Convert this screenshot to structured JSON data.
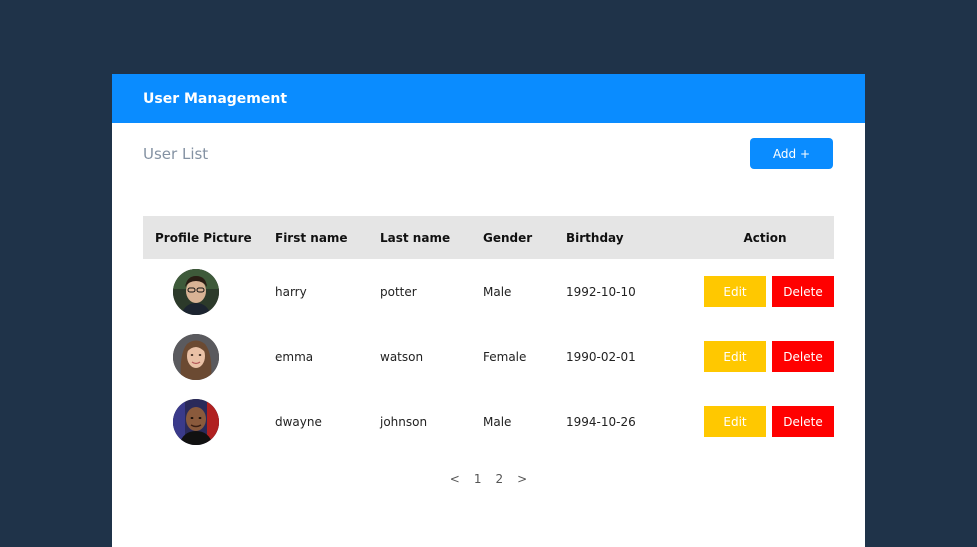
{
  "header": {
    "title": "User Management"
  },
  "subbar": {
    "title": "User List",
    "add_label": "Add +"
  },
  "table": {
    "columns": [
      "Profile Picture",
      "First name",
      "Last name",
      "Gender",
      "Birthday",
      "Action"
    ],
    "rows": [
      {
        "avatar": "harry-avatar",
        "first": "harry",
        "last": "potter",
        "gender": "Male",
        "birthday": "1992-10-10",
        "edit": "Edit",
        "delete": "Delete"
      },
      {
        "avatar": "emma-avatar",
        "first": "emma",
        "last": "watson",
        "gender": "Female",
        "birthday": "1990-02-01",
        "edit": "Edit",
        "delete": "Delete"
      },
      {
        "avatar": "dwayne-avatar",
        "first": "dwayne",
        "last": "johnson",
        "gender": "Male",
        "birthday": "1994-10-26",
        "edit": "Edit",
        "delete": "Delete"
      }
    ]
  },
  "pagination": {
    "prev": "<",
    "pages": [
      "1",
      "2"
    ],
    "next": ">"
  },
  "colors": {
    "accent": "#0a8cff",
    "background": "#1f3349",
    "edit": "#ffc800",
    "delete": "#ff0000"
  }
}
